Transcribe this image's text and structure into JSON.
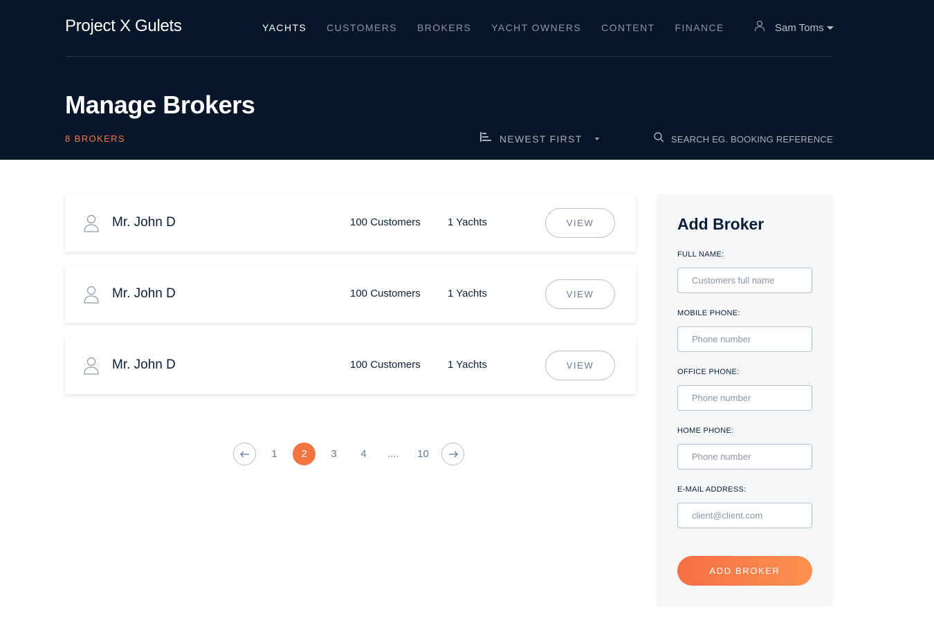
{
  "app": {
    "brand": "Project X Gulets"
  },
  "nav": {
    "items": [
      {
        "label": "YACHTS"
      },
      {
        "label": "CUSTOMERS"
      },
      {
        "label": "BROKERS"
      },
      {
        "label": "YACHT OWNERS"
      },
      {
        "label": "CONTENT"
      },
      {
        "label": "FINANCE"
      }
    ],
    "active": "YACHTS"
  },
  "user": {
    "name": "Sam Toms",
    "icon": "user-icon"
  },
  "page": {
    "title": "Manage Brokers",
    "count_label": "8 BROKERS",
    "sort_label": "NEWEST FIRST",
    "search_placeholder": "SEARCH EG. BOOKING REFERENCE"
  },
  "brokers": [
    {
      "name": "Mr. John D",
      "customers": "100 Customers",
      "yachts": "1 Yachts",
      "action": "VIEW"
    },
    {
      "name": "Mr. John D",
      "customers": "100 Customers",
      "yachts": "1 Yachts",
      "action": "VIEW"
    },
    {
      "name": "Mr. John D",
      "customers": "100 Customers",
      "yachts": "1 Yachts",
      "action": "VIEW"
    }
  ],
  "pagination": {
    "pages": [
      "1",
      "2",
      "3",
      "4",
      "....",
      "10"
    ],
    "current": "2"
  },
  "add_broker": {
    "title": "Add Broker",
    "fields": [
      {
        "label": "FULL NAME:",
        "placeholder": "Customers full name"
      },
      {
        "label": "MOBILE PHONE:",
        "placeholder": "Phone number"
      },
      {
        "label": "OFFICE PHONE:",
        "placeholder": "Phone number"
      },
      {
        "label": "HOME PHONE:",
        "placeholder": "Phone number"
      },
      {
        "label": "E-MAIL ADDRESS:",
        "placeholder": "client@client.com"
      }
    ],
    "submit_label": "ADD BROKER"
  },
  "colors": {
    "header_bg": "#071629",
    "accent": "#f4743f",
    "panel_bg": "#f5f6f8"
  }
}
